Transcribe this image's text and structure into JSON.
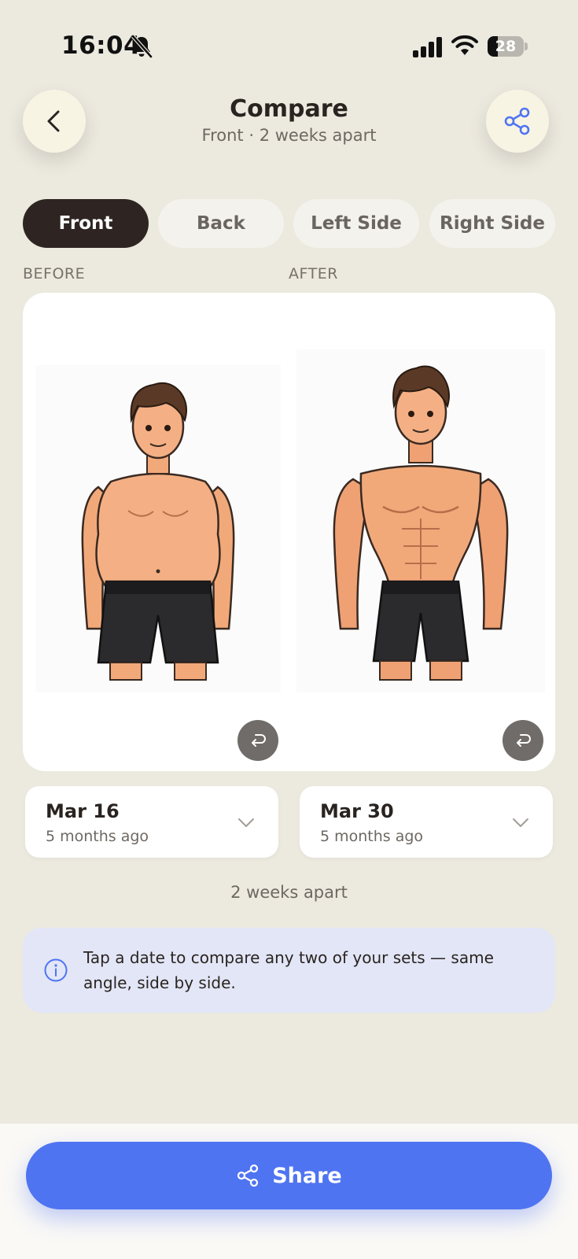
{
  "status_bar": {
    "time": "16:04",
    "battery": "28",
    "battery_level": 0.28,
    "icons": [
      "bell-off-icon",
      "signal-icon",
      "wifi-icon",
      "battery-icon"
    ]
  },
  "header": {
    "title": "Compare",
    "subtitle": "Front · 2 weeks apart",
    "back_icon": "chevron-left-icon",
    "share_icon": "share-icon"
  },
  "tabs": [
    {
      "label": "Front",
      "active": true
    },
    {
      "label": "Back",
      "active": false
    },
    {
      "label": "Left Side",
      "active": false
    },
    {
      "label": "Right Side",
      "active": false
    }
  ],
  "comparison": {
    "before_label": "BEFORE",
    "after_label": "AFTER",
    "swap_icon": "return-arrow-icon"
  },
  "dates": {
    "before": {
      "date": "Mar 16",
      "relative": "5 months ago"
    },
    "after": {
      "date": "Mar 30",
      "relative": "5 months ago"
    }
  },
  "apart_text": "2 weeks apart",
  "info": {
    "icon": "info-icon",
    "text": "Tap a date to compare any two of your sets — same angle, side by side."
  },
  "share_button": {
    "label": "Share",
    "icon": "share-icon"
  },
  "colors": {
    "background": "#ECE9DF",
    "active_tab": "#2E2523",
    "accent": "#4F74F2",
    "info_bg": "#E2E6F7"
  }
}
